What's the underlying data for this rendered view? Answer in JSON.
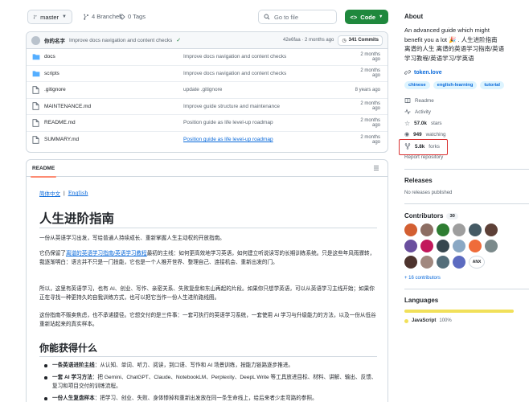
{
  "toolbar": {
    "branch": "master",
    "branches": "4 Branches",
    "tags": "0 Tags",
    "goto_placeholder": "Go to file",
    "code_label": "Code"
  },
  "latest_commit": {
    "author": "你的名字",
    "message": "Improve docs navigation and content checks",
    "hash_time": "42e6faa · 2 months ago",
    "commits": "341 Commits"
  },
  "files": [
    {
      "name": "docs",
      "type": "folder",
      "message": "Improve docs navigation and content checks",
      "date": "2 months ago",
      "link": false
    },
    {
      "name": "scripts",
      "type": "folder",
      "message": "Improve docs navigation and content checks",
      "date": "2 months ago",
      "link": false
    },
    {
      "name": ".gitignore",
      "type": "file",
      "message": "update .gitignore",
      "date": "8 years ago",
      "link": false
    },
    {
      "name": "MAINTENANCE.md",
      "type": "file",
      "message": "Improve guide structure and maintenance",
      "date": "2 months ago",
      "link": false
    },
    {
      "name": "README.md",
      "type": "file",
      "message": "Position guide as life level-up roadmap",
      "date": "2 months ago",
      "link": false
    },
    {
      "name": "SUMMARY.md",
      "type": "file",
      "message": "Position guide as life level-up roadmap",
      "date": "2 months ago",
      "link": true
    }
  ],
  "readme": {
    "tab": "README",
    "lang_zh": "简体中文",
    "lang_sep": "|",
    "lang_en": "English",
    "title": "人生进阶指南",
    "p1": "一份从英语学习出发，写给普通人持续成长、重新掌握人生主动权的开放指南。",
    "p2_pre": "它仍保留了",
    "p2_link": "离谱的英语学习指南/英语学习教程",
    "p2_post": "最初的主线：如何更高效地学习英语，如何建立听说读写的长期训练系统。只是这些年风雨骤转，我逐渐明白：语言并不只是一门技能，它也是一个人推开世界、整理自己、连接机会、重新出发的门。",
    "p3": "所以，这里有英语学习，也有 AI、创业、写作、亲密关系、失败复盘和东山再起的片段。如果你只想学英语，可以从英语学习主线开始；如果你正在寻找一种更持久的自我训练方式，也可以把它当作一份人生进阶路线图。",
    "p4": "这份指南不贩卖焦虑，也不承诺捷径。它想交付的是三件事：一套可执行的英语学习系统，一套使用 AI 学习与升级能力的方法，以及一份从低谷重新站起来的真实样本。",
    "section": "你能获得什么",
    "features": [
      {
        "bold": "一条英语进阶主线",
        "text": "：从认知、单词、听力、阅读，到口语、写作和 AI 场景训练，按能力链路逐步推进。"
      },
      {
        "bold": "一套 AI 学习方法",
        "text": "：把 Gemini、ChatGPT、Claude、NotebookLM、Perplexity、DeepL Write 等工具放进目标、材料、讲解、输出、反馈、复习和项目交付的训练流程。"
      },
      {
        "bold": "一份人生复盘样本",
        "text": "：把学习、创业、失败、身体惨掉和重新出发放在同一条生命线上，给后来者少走弯路的参照。"
      }
    ]
  },
  "about": {
    "title": "About",
    "description": "An advanced guide which might benefit you a lot 🎉 . 人生进阶指南 离谱的人生 离谱的英语学习指南/英语学习教程/英语学习/学英语",
    "website": "token.love",
    "topics": [
      "chinese",
      "english-learning",
      "tutorial"
    ],
    "readme": "Readme",
    "activity": "Activity",
    "stars_num": "57.0k",
    "stars_label": "stars",
    "watching_num": "949",
    "watching_label": "watching",
    "forks_num": "5.8k",
    "forks_label": "forks",
    "report": "Report repository"
  },
  "releases": {
    "title": "Releases",
    "none": "No releases published"
  },
  "contributors": {
    "title": "Contributors",
    "count": "30",
    "names": [
      "ANX"
    ],
    "more": "+ 16 contributors"
  },
  "languages": {
    "title": "Languages",
    "name": "JavaScript",
    "percent": "100%",
    "percent_value": 100,
    "color": "#f1e05a"
  },
  "colors": {
    "accent": "#0969da",
    "code_button": "#1f883d",
    "highlight": "#d93131"
  }
}
